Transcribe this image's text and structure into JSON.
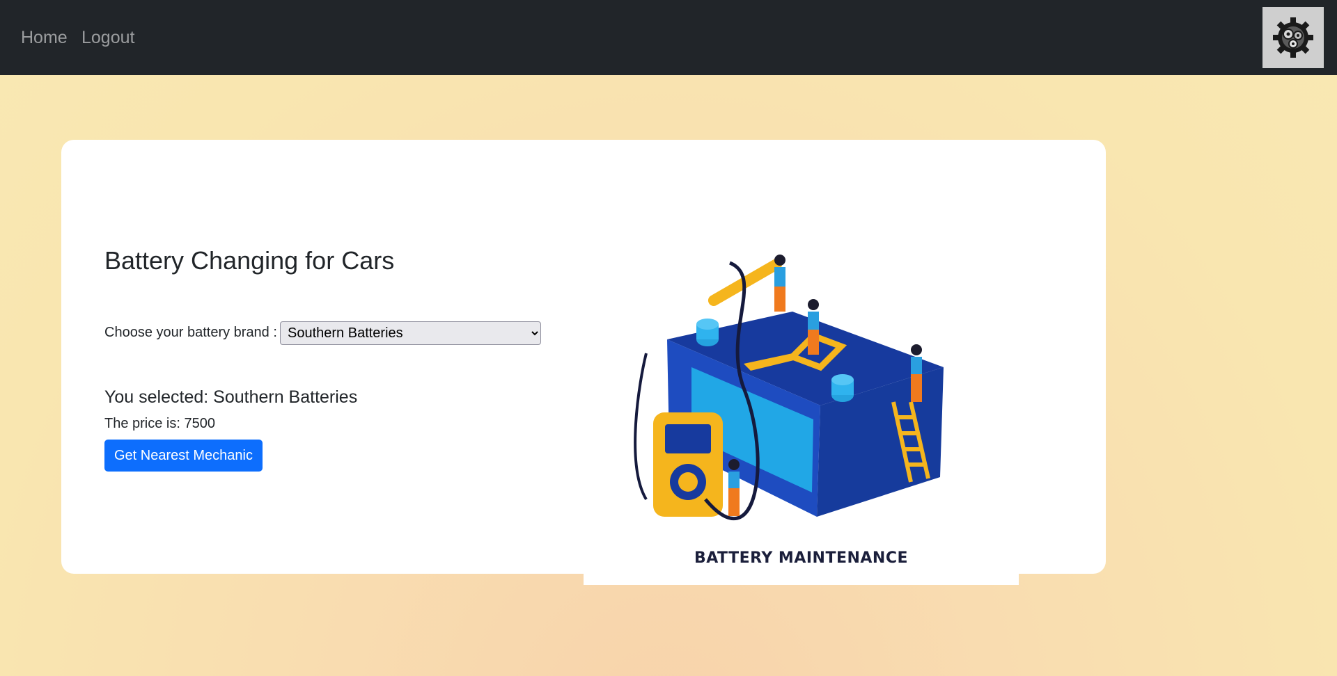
{
  "nav": {
    "home_label": "Home",
    "logout_label": "Logout",
    "logo_icon": "gears-icon"
  },
  "main": {
    "title": "Battery Changing for Cars",
    "choose_label": "Choose your battery brand :",
    "brand_select": {
      "selected": "Southern Batteries",
      "options": [
        "Southern Batteries"
      ]
    },
    "selected_text": "You selected: Southern Batteries",
    "price_text": "The price is: 7500",
    "mechanic_button_label": "Get Nearest Mechanic"
  },
  "illustration": {
    "caption": "BATTERY MAINTENANCE",
    "colors": {
      "battery": "#1b3fa8",
      "accent": "#f5b51d",
      "worker": "#f07a1e"
    }
  },
  "colors": {
    "navbar": "#212529",
    "primary_button": "#0d6efd",
    "background": "#f9e6b0"
  }
}
